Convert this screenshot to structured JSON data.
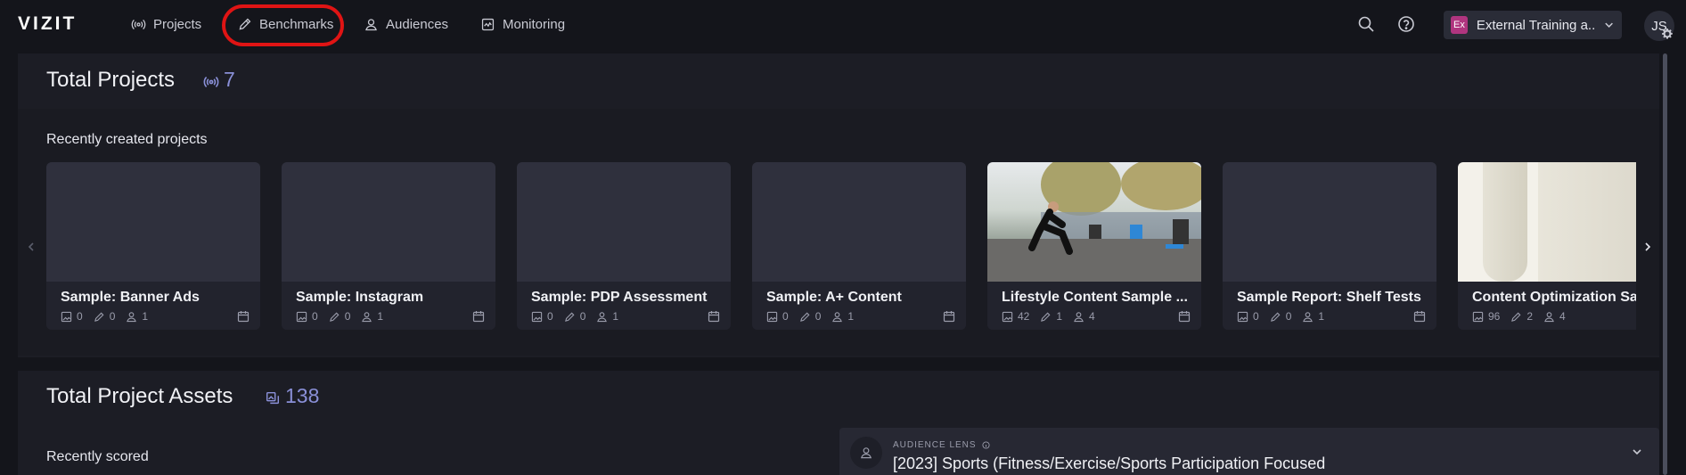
{
  "app": {
    "logo": "VIZIT"
  },
  "nav": {
    "projects": "Projects",
    "benchmarks": "Benchmarks",
    "audiences": "Audiences",
    "monitoring": "Monitoring"
  },
  "header": {
    "org_badge": "Ex",
    "org_name": "External Training a...",
    "avatar_initials": "JS"
  },
  "projects_section": {
    "title": "Total Projects",
    "count": "7",
    "subtitle": "Recently created projects",
    "cards": [
      {
        "title": "Sample: Banner Ads",
        "images": "0",
        "benchmarks": "0",
        "audiences": "1",
        "thumb": "placeholder"
      },
      {
        "title": "Sample: Instagram",
        "images": "0",
        "benchmarks": "0",
        "audiences": "1",
        "thumb": "placeholder"
      },
      {
        "title": "Sample: PDP Assessment",
        "images": "0",
        "benchmarks": "0",
        "audiences": "1",
        "thumb": "placeholder"
      },
      {
        "title": "Sample: A+ Content",
        "images": "0",
        "benchmarks": "0",
        "audiences": "1",
        "thumb": "placeholder"
      },
      {
        "title": "Lifestyle Content Sample ...",
        "images": "42",
        "benchmarks": "1",
        "audiences": "4",
        "thumb": "photo-runner"
      },
      {
        "title": "Sample Report: Shelf Tests",
        "images": "0",
        "benchmarks": "0",
        "audiences": "1",
        "thumb": "placeholder"
      },
      {
        "title": "Content Optimization Sa",
        "images": "96",
        "benchmarks": "2",
        "audiences": "4",
        "thumb": "photo-cup"
      }
    ]
  },
  "assets_section": {
    "title": "Total Project Assets",
    "count": "138",
    "subtitle": "Recently scored"
  },
  "audience_lens": {
    "label": "AUDIENCE LENS",
    "value": "[2023] Sports (Fitness/Exercise/Sports Participation Focused"
  },
  "colors": {
    "accent": "#8a90d8",
    "highlight": "#e01414",
    "org_badge": "#b0357f"
  }
}
